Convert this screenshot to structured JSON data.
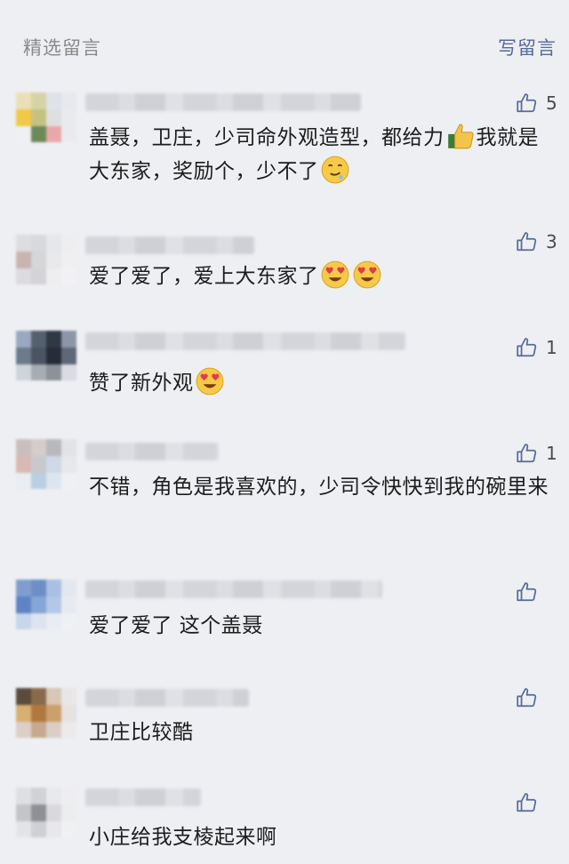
{
  "header": {
    "title": "精选留言",
    "write_label": "写留言"
  },
  "colors": {
    "link": "#576b95",
    "background": "#eeeff3"
  },
  "comments": [
    {
      "avatar": [
        "#eadfb6",
        "#d8d3a7",
        "#dfe2e8",
        "#e8e9ee",
        "#f0c948",
        "#c4c27f",
        "#dedfe3",
        "#e9eaee",
        "#eff0f3",
        "#6b8a5a",
        "#e8a8a8",
        "#eaeaee"
      ],
      "text_a": "盖聂，卫庄，少司命外观造型，都给力",
      "text_b": "我就是大东家，奖励个，少不了",
      "likes": "5"
    },
    {
      "avatar": [
        "#dcdde1",
        "#d8d9dd",
        "#e6e7ea",
        "#eeeef1",
        "#c9b5b0",
        "#d6d5d8",
        "#e9e9ec",
        "#efeff2",
        "#dcdbe0",
        "#d3d3d8",
        "#eeeef1",
        "#f1f1f4"
      ],
      "text_a": "爱了爱了，爱上大东家了",
      "likes": "3"
    },
    {
      "avatar": [
        "#9aa8c2",
        "#55606f",
        "#2f3845",
        "#8b96a8",
        "#6d7a8c",
        "#4a5462",
        "#262d38",
        "#5e6878",
        "#cfd3da",
        "#a8acb4",
        "#8c919a",
        "#d9dce1"
      ],
      "text_a": "赞了新外观",
      "likes": "1"
    },
    {
      "avatar": [
        "#c9bfbf",
        "#d5cccb",
        "#b9b9bd",
        "#e2e3e7",
        "#d9b9b5",
        "#c8c9cd",
        "#cfd8e6",
        "#e6e8ec",
        "#e9ecf1",
        "#b9cfe3",
        "#dde5ee",
        "#eef0f3"
      ],
      "text_a": "不错，角色是我喜欢的，少司令快快到我的碗里来",
      "likes": "1"
    },
    {
      "avatar": [
        "#7f9ecf",
        "#6e8fc6",
        "#a9bfe3",
        "#e3e7ef",
        "#5f84c4",
        "#86a6d6",
        "#b4c7e6",
        "#e7eaf1",
        "#c8d5ea",
        "#dde4f0",
        "#e9ecf2",
        "#eef0f4"
      ],
      "text_a": "爱了爱了 这个盖聂",
      "likes": ""
    },
    {
      "avatar": [
        "#5c4a3e",
        "#8a6a4c",
        "#d8c7b5",
        "#e8e6e6",
        "#d7b070",
        "#b0783f",
        "#caa06c",
        "#e5e2e0",
        "#dccfc7",
        "#c6a98e",
        "#d9cfc6",
        "#eceaea"
      ],
      "text_a": "卫庄比较酷",
      "likes": ""
    },
    {
      "avatar": [
        "#dedfe3",
        "#d1d2d6",
        "#e8e9ec",
        "#eeeef1",
        "#c4c5c9",
        "#8f9095",
        "#d9d9dd",
        "#eceded",
        "#e3e4e7",
        "#cfd0d4",
        "#e8e8eb",
        "#f0f0f3"
      ],
      "text_a": "小庄给我支棱起来啊",
      "likes": ""
    }
  ]
}
